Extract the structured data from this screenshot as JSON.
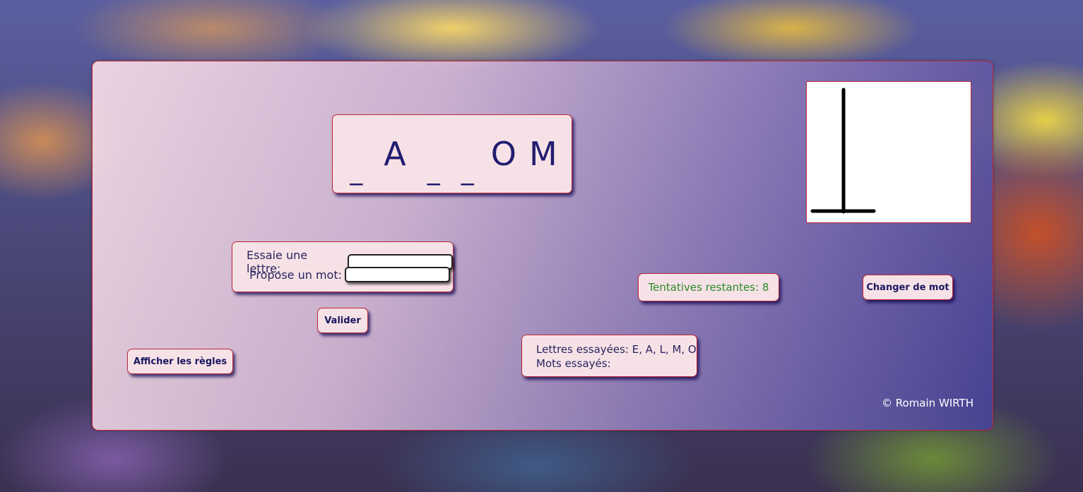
{
  "game": {
    "word_letters": [
      "_",
      "A",
      "_",
      "_",
      "O",
      "M"
    ],
    "tries_remaining": "Tentatives restantes: 8",
    "letters_tried": "Lettres essayées: E, A, L, M, O",
    "words_tried": "Mots essayés:",
    "footer": "© Romain WIRTH"
  },
  "form": {
    "letter_label": "Essaie une lettre:",
    "letter_value": "",
    "word_label": "Propose un mot:",
    "word_value": ""
  },
  "buttons": {
    "validate": "Valider",
    "show_rules": "Afficher les règles",
    "change_word": "Changer de mot"
  },
  "colors": {
    "accent_border": "#c0283a",
    "tries_text": "#2a8a2a",
    "text_primary": "#221c70"
  }
}
